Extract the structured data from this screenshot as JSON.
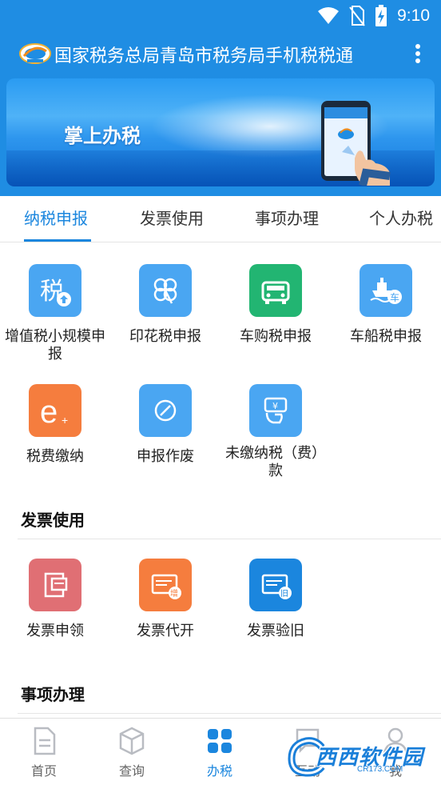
{
  "status_bar": {
    "time": "9:10"
  },
  "header": {
    "title": "国家税务总局青岛市税务局手机税税通"
  },
  "banner": {
    "text": "掌上办税"
  },
  "tabs": [
    {
      "label": "纳税申报",
      "active": true
    },
    {
      "label": "发票使用",
      "active": false
    },
    {
      "label": "事项办理",
      "active": false
    },
    {
      "label": "个人办税",
      "active": false
    }
  ],
  "tax_declaration": {
    "items": [
      {
        "label": "增值税小规模申报",
        "icon": "tax-upload-icon",
        "color": "#4aa6f2"
      },
      {
        "label": "印花税申报",
        "icon": "clover-icon",
        "color": "#4aa6f2"
      },
      {
        "label": "车购税申报",
        "icon": "car-icon",
        "color": "#22b572"
      },
      {
        "label": "车船税申报",
        "icon": "ship-icon",
        "color": "#4aa6f2"
      },
      {
        "label": "税费缴纳",
        "icon": "e-pay-icon",
        "color": "#f57d3e"
      },
      {
        "label": "申报作废",
        "icon": "void-icon",
        "color": "#4aa6f2"
      },
      {
        "label": "未缴纳税（费）款",
        "icon": "hand-money-icon",
        "color": "#4aa6f2"
      }
    ]
  },
  "invoice_section": {
    "title": "发票使用",
    "items": [
      {
        "label": "发票申领",
        "icon": "invoice-apply-icon",
        "color": "#e06f74"
      },
      {
        "label": "发票代开",
        "icon": "invoice-issue-icon",
        "color": "#f57d3e"
      },
      {
        "label": "发票验旧",
        "icon": "invoice-verify-icon",
        "color": "#1b86de"
      }
    ]
  },
  "matters_section": {
    "title": "事项办理"
  },
  "bottom_nav": [
    {
      "label": "首页",
      "icon": "document-icon",
      "active": false
    },
    {
      "label": "查询",
      "icon": "box-icon",
      "active": false
    },
    {
      "label": "办税",
      "icon": "grid-icon",
      "active": true
    },
    {
      "label": "互动",
      "icon": "chat-icon",
      "active": false
    },
    {
      "label": "我",
      "icon": "person-icon",
      "active": false
    }
  ],
  "watermark": {
    "text": "西西软件园",
    "sub": "CR173.COM"
  },
  "colors": {
    "primary": "#1f8de3",
    "accent": "#1b86de"
  }
}
